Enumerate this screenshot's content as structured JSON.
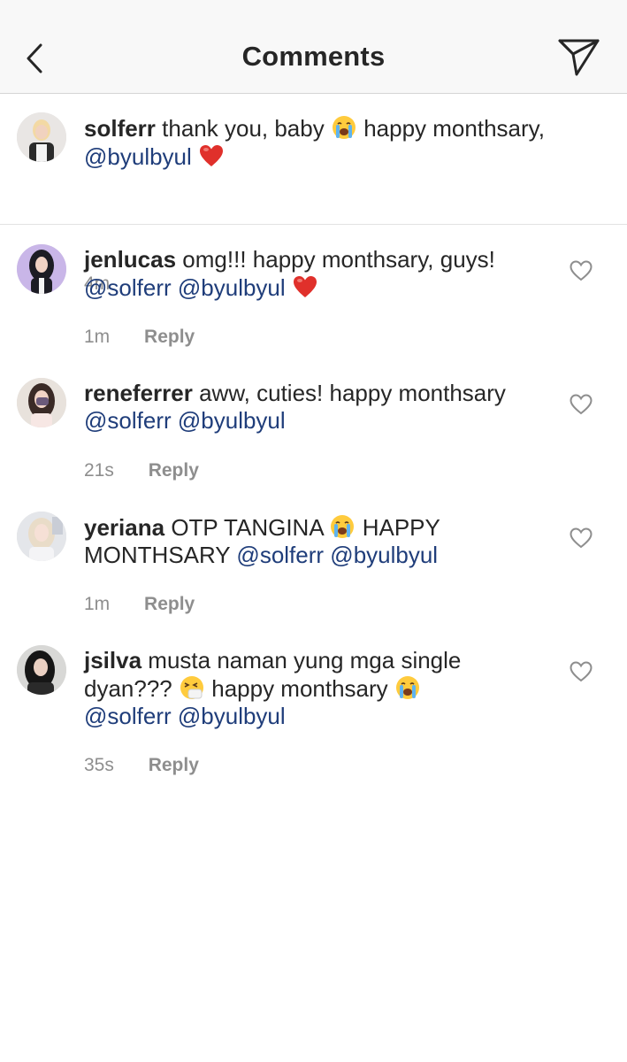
{
  "header": {
    "title": "Comments",
    "back_icon": "chevron-left-icon",
    "send_icon": "paper-plane-icon"
  },
  "caption": {
    "username": "solferr",
    "text": "thank you, baby",
    "text2": "happy monthsary,",
    "mention": "@byulbyul",
    "time": "4m"
  },
  "comments": [
    {
      "username": "jenlucas",
      "text": "omg!!! happy monthsary, guys!",
      "mentions": [
        "@solferr",
        "@byulbyul"
      ],
      "time": "1m",
      "reply": "Reply"
    },
    {
      "username": "reneferrer",
      "text": "aww, cuties! happy monthsary",
      "mentions": [
        "@solferr",
        "@byulbyul"
      ],
      "time": "21s",
      "reply": "Reply"
    },
    {
      "username": "yeriana",
      "text": "OTP TANGINA",
      "text2": "HAPPY MONTHSARY",
      "mentions": [
        "@solferr",
        "@byulbyul"
      ],
      "time": "1m",
      "reply": "Reply"
    },
    {
      "username": "jsilva",
      "text": "musta naman yung mga single dyan???",
      "text2": "happy monthsary",
      "mentions": [
        "@solferr",
        "@byulbyul"
      ],
      "time": "35s",
      "reply": "Reply"
    }
  ],
  "colors": {
    "mention": "#1f3d7a",
    "meta": "#8e8e8e",
    "header_bg": "#f8f8f8",
    "text": "#262626"
  }
}
